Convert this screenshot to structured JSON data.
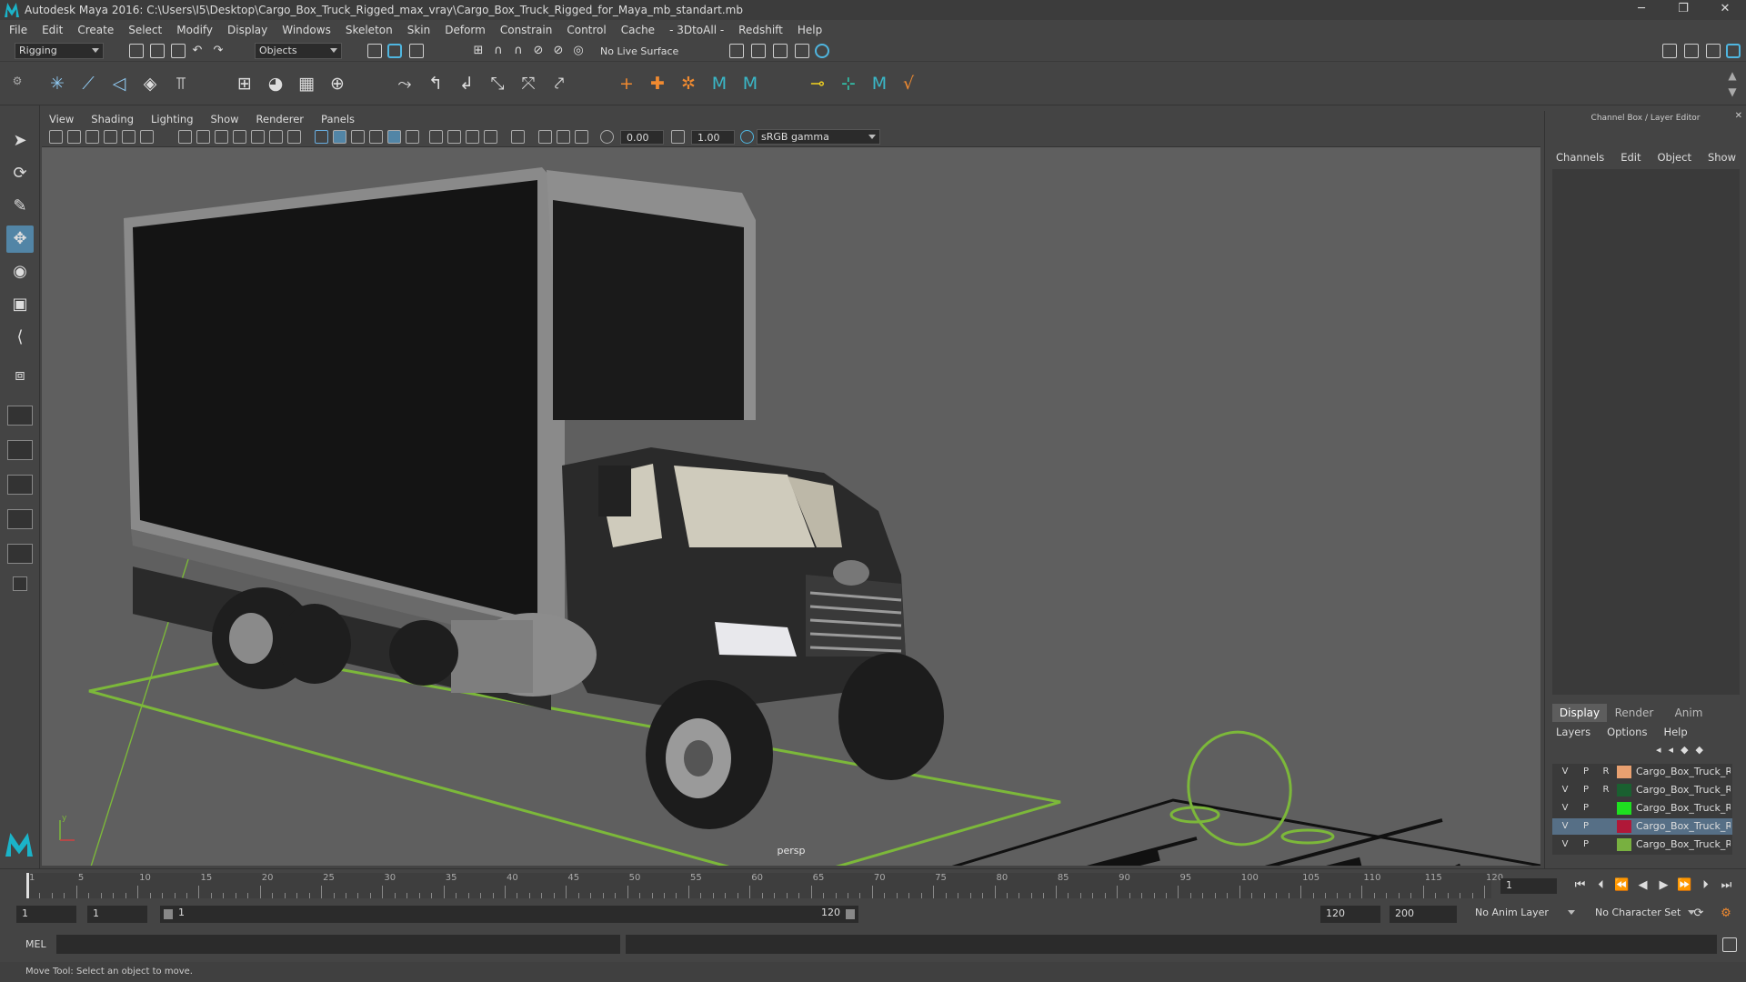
{
  "window": {
    "title": "Autodesk Maya 2016: C:\\Users\\I5\\Desktop\\Cargo_Box_Truck_Rigged_max_vray\\Cargo_Box_Truck_Rigged_for_Maya_mb_standart.mb",
    "minimize": "─",
    "restore": "❐",
    "close": "✕"
  },
  "menubar": [
    "File",
    "Edit",
    "Create",
    "Select",
    "Modify",
    "Display",
    "Windows",
    "Skeleton",
    "Skin",
    "Deform",
    "Constrain",
    "Control",
    "Cache",
    "- 3DtoAll -",
    "Redshift",
    "Help"
  ],
  "statusline": {
    "menuset": "Rigging",
    "selection_mode": "Objects",
    "live_surface": "No Live Surface"
  },
  "panel": {
    "menu": [
      "View",
      "Shading",
      "Lighting",
      "Show",
      "Renderer",
      "Panels"
    ],
    "exposure": "0.00",
    "gamma": "1.00",
    "colorspace": "sRGB gamma",
    "camera_label": "persp"
  },
  "right_panel": {
    "title": "Channel Box / Layer Editor",
    "channel_menu": [
      "Channels",
      "Edit",
      "Object",
      "Show"
    ],
    "tabs": [
      "Display",
      "Render",
      "Anim"
    ],
    "layer_menu": [
      "Layers",
      "Options",
      "Help"
    ],
    "layers": [
      {
        "v": "V",
        "p": "P",
        "r": "R",
        "color": "#e8a070",
        "name": "Cargo_Box_Truck_Ri",
        "selected": false
      },
      {
        "v": "V",
        "p": "P",
        "r": "R",
        "color": "#1a6030",
        "name": "Cargo_Box_Truck_Ri",
        "selected": false
      },
      {
        "v": "V",
        "p": "P",
        "r": "",
        "color": "#1ee020",
        "name": "Cargo_Box_Truck_Ri",
        "selected": false
      },
      {
        "v": "V",
        "p": "P",
        "r": "",
        "color": "#b01838",
        "name": "Cargo_Box_Truck_Ri",
        "selected": true
      },
      {
        "v": "V",
        "p": "P",
        "r": "",
        "color": "#78b040",
        "name": "Cargo_Box_Truck_Ri",
        "selected": false
      }
    ]
  },
  "timeline": {
    "start": 1,
    "end": 120,
    "labels": [
      "1",
      "5",
      "10",
      "15",
      "20",
      "25",
      "30",
      "35",
      "40",
      "45",
      "50",
      "55",
      "60",
      "65",
      "70",
      "75",
      "80",
      "85",
      "90",
      "95",
      "100",
      "105",
      "110",
      "115",
      "120"
    ],
    "current_frame": "1"
  },
  "range": {
    "start": "1",
    "playback_start": "1",
    "slider_start": "1",
    "slider_end": "120",
    "playback_end": "120",
    "end": "200",
    "anim_layer": "No Anim Layer",
    "char_set": "No Character Set"
  },
  "cmdline": {
    "lang": "MEL"
  },
  "helpline": "Move Tool: Select an object to move.",
  "colors": {
    "accent": "#5285a6",
    "rig_green": "#7cb83a"
  }
}
